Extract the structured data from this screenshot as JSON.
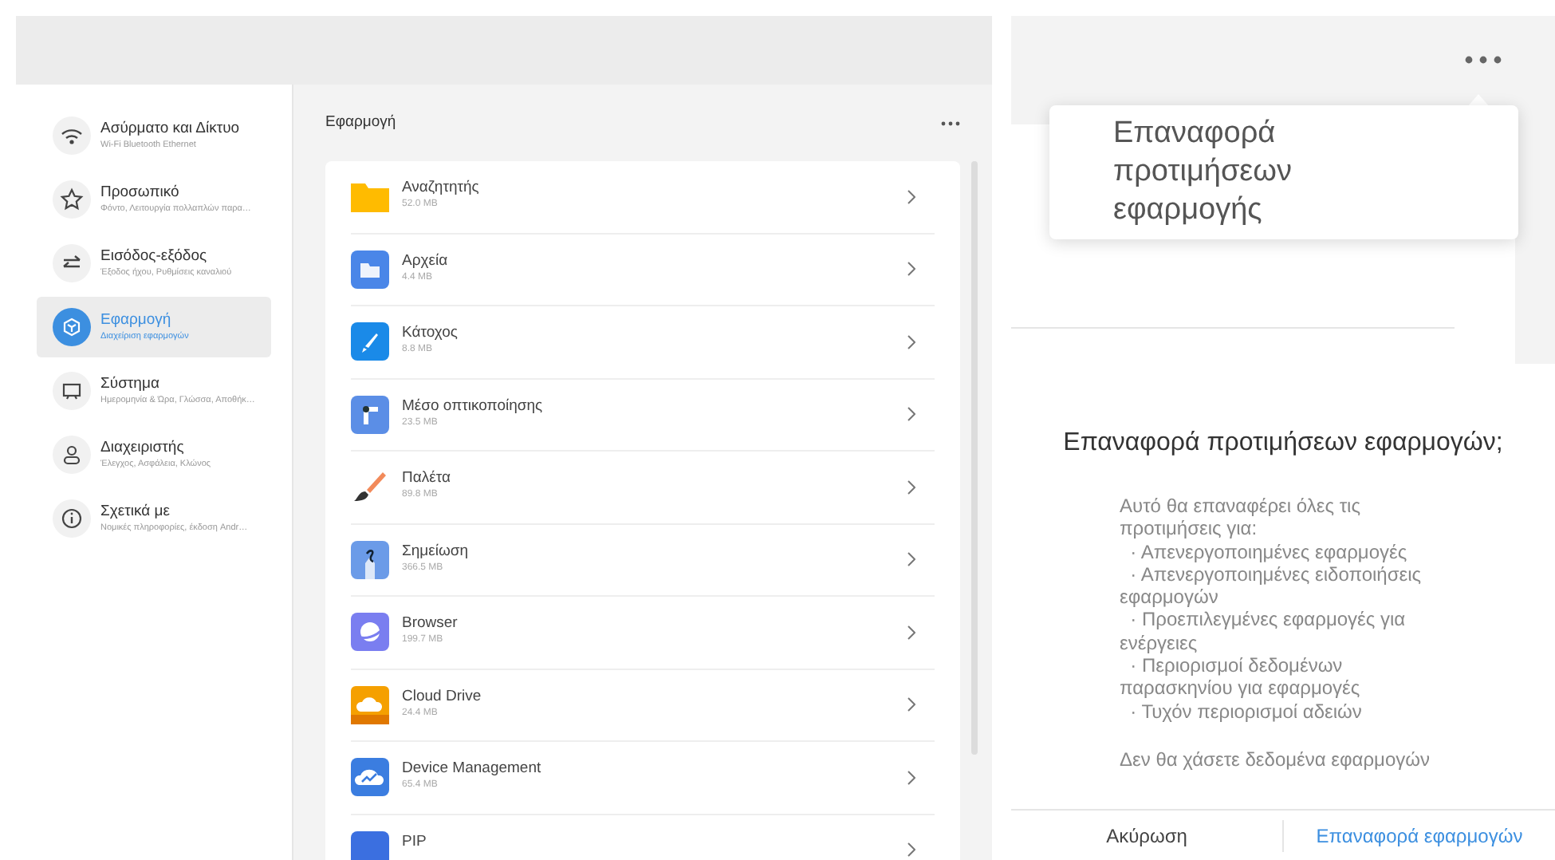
{
  "sidebar": {
    "items": [
      {
        "title": "Ασύρματο και Δίκτυο",
        "subtitle": "Wi-Fi Bluetooth Ethernet",
        "selected": false
      },
      {
        "title": "Προσωπικό",
        "subtitle": "Φόντο, Λειτουργία πολλαπλών παρα…",
        "selected": false
      },
      {
        "title": "Εισόδος-εξόδος",
        "subtitle": "Έξοδος ήχου, Ρυθμίσεις καναλιού",
        "selected": false
      },
      {
        "title": "Εφαρμογή",
        "subtitle": "Διαχείριση εφαρμογών",
        "selected": true
      },
      {
        "title": "Σύστημα",
        "subtitle": "Ημερομηνία & Ώρα, Γλώσσα, Αποθήκ…",
        "selected": false
      },
      {
        "title": "Διαχειριστής",
        "subtitle": "Έλεγχος, Ασφάλεια, Κλώνος",
        "selected": false
      },
      {
        "title": "Σχετικά με",
        "subtitle": "Νομικές πληροφορίες, έκδοση Andr…",
        "selected": false
      }
    ]
  },
  "content": {
    "title": "Εφαρμογή",
    "apps": [
      {
        "name": "Αναζητητής",
        "size": "52.0 MB"
      },
      {
        "name": "Αρχεία",
        "size": "4.4 MB"
      },
      {
        "name": "Κάτοχος",
        "size": "8.8 MB"
      },
      {
        "name": "Μέσο οπτικοποίησης",
        "size": "23.5 MB"
      },
      {
        "name": "Παλέτα",
        "size": "89.8 MB"
      },
      {
        "name": "Σημείωση",
        "size": "366.5 MB"
      },
      {
        "name": "Browser",
        "size": "199.7 MB"
      },
      {
        "name": "Cloud Drive",
        "size": "24.4 MB"
      },
      {
        "name": "Device Management",
        "size": "65.4 MB"
      },
      {
        "name": "PIP"
      }
    ]
  },
  "menu_popup": {
    "items": [
      {
        "label": "Επαναφορά προτιμήσεων εφαρμογής"
      }
    ]
  },
  "dialog": {
    "title": "Επαναφορά προτιμήσεων εφαρμογών;",
    "message": "Αυτό θα επαναφέρει όλες τις προτιμήσεις για:\n  · Απενεργοποιημένες εφαρμογές\n  · Απενεργοποιημένες ειδοποιήσεις εφαρμογών\n  · Προεπιλεγμένες εφαρμογές για ενέργειες\n  · Περιορισμοί δεδομένων παρασκηνίου για εφαρμογές\n  · Τυχόν περιορισμοί αδειών",
    "note": "Δεν θα χάσετε δεδομένα εφαρμογών",
    "buttons": [
      {
        "label": "Ακύρωση",
        "kind": "cancel"
      },
      {
        "label": "Επαναφορά εφαρμογών",
        "kind": "confirm"
      }
    ]
  }
}
